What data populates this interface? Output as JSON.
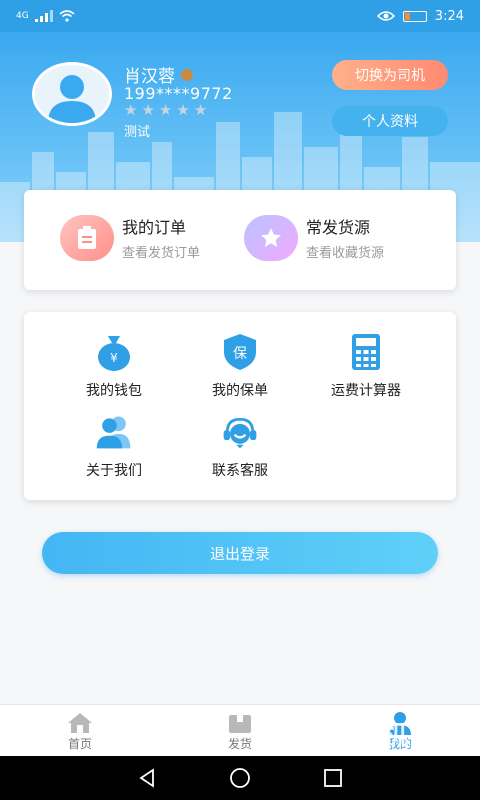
{
  "status_bar": {
    "network": "4G",
    "time": "3:24"
  },
  "profile": {
    "name": "肖汉蓉",
    "phone": "199****9772",
    "rating_stars": 5,
    "rating_filled": 0,
    "tag": "测试",
    "switch_button": "切换为司机",
    "profile_button": "个人资料"
  },
  "orders": [
    {
      "title": "我的订单",
      "subtitle": "查看发货订单",
      "icon": "clipboard-icon"
    },
    {
      "title": "常发货源",
      "subtitle": "查看收藏货源",
      "icon": "star-icon"
    }
  ],
  "menu": [
    {
      "label": "我的钱包",
      "icon": "wallet-icon"
    },
    {
      "label": "我的保单",
      "icon": "shield-icon"
    },
    {
      "label": "运费计算器",
      "icon": "calculator-icon"
    },
    {
      "label": "关于我们",
      "icon": "users-icon"
    },
    {
      "label": "联系客服",
      "icon": "headset-icon"
    }
  ],
  "logout_button": "退出登录",
  "tabbar": [
    {
      "label": "首页",
      "icon": "home-icon",
      "active": false
    },
    {
      "label": "发货",
      "icon": "box-icon",
      "active": false
    },
    {
      "label": "我的",
      "icon": "person-icon",
      "active": true
    }
  ],
  "watermark": {
    "brand": "手机鼠",
    "url": "SHOUJISHU.COM"
  },
  "colors": {
    "primary": "#2f9fe6",
    "accent_orange": "#ff8a72",
    "badge_gold": "#c98a46"
  }
}
